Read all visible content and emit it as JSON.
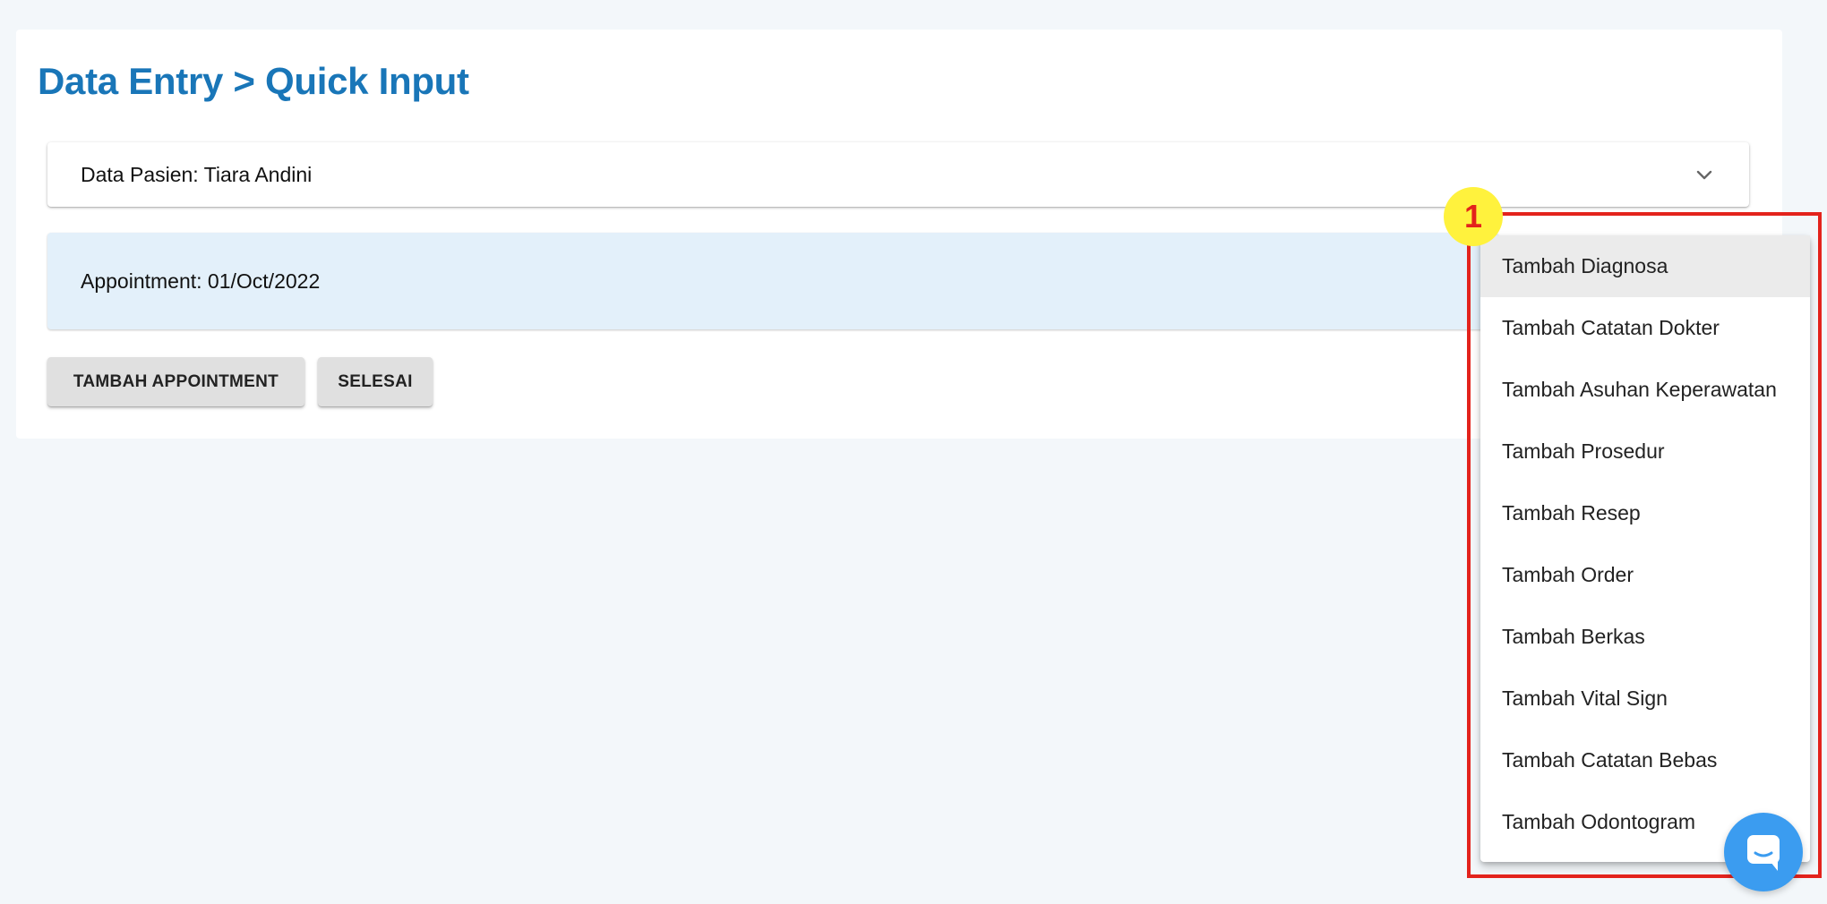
{
  "header": {
    "title": "Data Entry > Quick Input"
  },
  "patient_panel": {
    "label": "Data Pasien: Tiara Andini",
    "chevron_icon": "chevron-down-icon"
  },
  "appointment": {
    "label": "Appointment: 01/Oct/2022"
  },
  "actions": {
    "add_appointment_label": "TAMBAH APPOINTMENT",
    "finish_label": "SELESAI"
  },
  "menu": {
    "items": [
      {
        "label": "Tambah Diagnosa",
        "active": true
      },
      {
        "label": "Tambah Catatan Dokter"
      },
      {
        "label": "Tambah Asuhan Keperawatan"
      },
      {
        "label": "Tambah Prosedur"
      },
      {
        "label": "Tambah Resep"
      },
      {
        "label": "Tambah Order"
      },
      {
        "label": "Tambah Berkas"
      },
      {
        "label": "Tambah Vital Sign"
      },
      {
        "label": "Tambah Catatan Bebas"
      },
      {
        "label": "Tambah Odontogram"
      }
    ]
  },
  "annotation": {
    "marker_label": "1"
  },
  "chat": {
    "icon": "chat-icon"
  },
  "colors": {
    "title": "#1976b8",
    "background": "#f3f7fa",
    "appointment_bg": "#e3f0fa",
    "button_bg": "#e0e0e0",
    "menu_active_bg": "#ebebeb",
    "highlight": "#e3231c",
    "marker_bg": "#fff23d",
    "chat_fab": "#3b9cf0"
  }
}
